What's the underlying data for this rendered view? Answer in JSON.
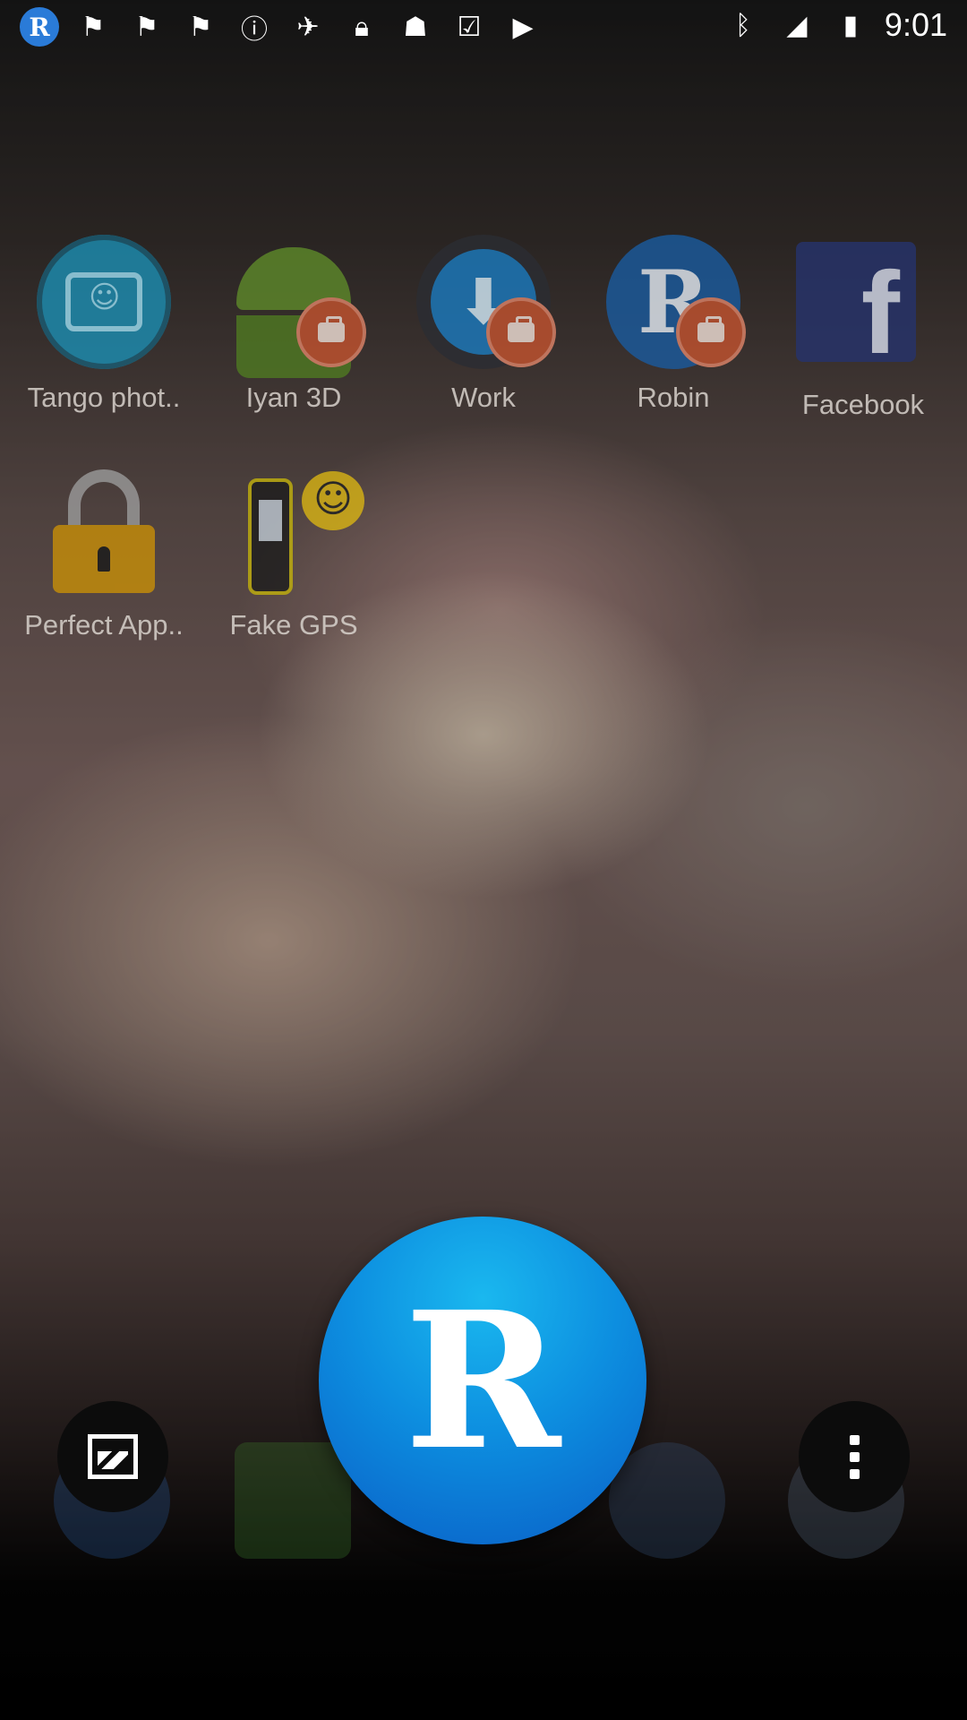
{
  "status_bar": {
    "time": "9:01",
    "left_icons": [
      "robin-app-icon",
      "fake-gps-icon",
      "fake-gps-icon",
      "fake-gps-icon",
      "info-icon",
      "satellite-icon",
      "lock-icon",
      "android-icon",
      "checklist-icon",
      "play-store-icon"
    ],
    "right_icons": [
      "bluetooth-icon",
      "signal-icon",
      "battery-icon"
    ]
  },
  "apps": [
    {
      "label": "Tango phot..",
      "icon": "tango-camera-icon",
      "badge": false
    },
    {
      "label": "Iyan 3D",
      "icon": "android-icon",
      "badge": true
    },
    {
      "label": "Work",
      "icon": "download-icon",
      "badge": true
    },
    {
      "label": "Robin",
      "icon": "robin-icon",
      "badge": true
    },
    {
      "label": "Facebook",
      "icon": "facebook-icon",
      "badge": false
    },
    {
      "label": "Perfect App..",
      "icon": "padlock-icon",
      "badge": false
    },
    {
      "label": "Fake GPS",
      "icon": "gps-device-icon",
      "badge": false
    }
  ],
  "fab": {
    "letter": "R"
  },
  "colors": {
    "fab_light": "#1ab8ef",
    "fab_dark": "#0a5ec6",
    "badge": "#c4532f"
  }
}
